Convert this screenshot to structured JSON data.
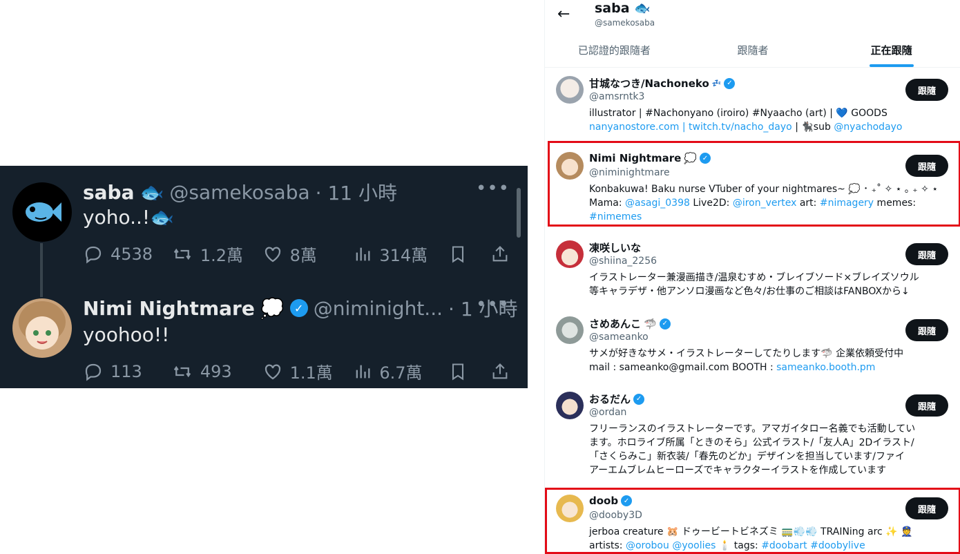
{
  "left_panel": {
    "tweets": [
      {
        "name": "saba",
        "name_emoji": "🐟",
        "handle": "@samekosaba",
        "time": "· 11 小時",
        "more": "•••",
        "text": "yoho..!",
        "text_emoji": "🐟",
        "replies": "4538",
        "retweets": "1.2萬",
        "likes": "8萬",
        "views": "314萬"
      },
      {
        "name": "Nimi Nightmare",
        "name_emoji": "💭",
        "handle": "@niminight...",
        "time": "· 1 小時",
        "more": "•••",
        "text": "yoohoo!!",
        "replies": "113",
        "retweets": "493",
        "likes": "1.1萬",
        "views": "6.7萬"
      }
    ]
  },
  "right_panel": {
    "back": "←",
    "title": "saba",
    "title_emoji": "🐟",
    "subtitle": "@samekosaba",
    "tabs": [
      "已認證的跟隨者",
      "跟隨者",
      "正在跟隨"
    ],
    "active_tab": 2,
    "follow_label": "跟隨",
    "users": [
      {
        "name": "甘城なつき/Nachoneko",
        "name_suffix": "💤",
        "handle": "@amsrntk3",
        "bio_line1": "illustrator | #Nachonyano (iroiro) #Nyaacho (art) | 💙 GOODS",
        "bio_line2_links": "nanyanostore.com | twitch.tv/nacho_dayo",
        "bio_line2_text": " | 🐈‍⬛sub ",
        "bio_line2_link2": "@nyachodayo"
      },
      {
        "name": "Nimi Nightmare",
        "name_suffix": "💭",
        "handle": "@niminightmare",
        "bio_line1": "Konbakuwa! Baku nurse VTuber of your nightmares~ 💭 ･ ₊˚ ✧ ⋆ ｡ ₊ ✧ ⋆",
        "bio_line2_a": "Mama: ",
        "bio_line2_b": "@asagi_0398",
        "bio_line2_c": " Live2D: ",
        "bio_line2_d": "@iron_vertex",
        "bio_line2_e": " art: ",
        "bio_line2_f": "#nimagery",
        "bio_line2_g": " memes:",
        "bio_line3": "#nimemes"
      },
      {
        "name": "凍咲しいな",
        "handle": "@shiina_2256",
        "bio_line1": "イラストレーター兼漫画描き/温泉むすめ・ブレイブソード×ブレイズソウル",
        "bio_line2": "等キャラデザ・他アンソロ漫画など色々/お仕事のご相談はFANBOXから↓"
      },
      {
        "name": "さめあんこ",
        "name_suffix": "🦈",
        "handle": "@sameanko",
        "bio_line1": "サメが好きなサメ・イラストレーターしてたりします🦈 企業依頼受付中",
        "bio_line2_text": "mail : sameanko@gmail.com BOOTH : ",
        "bio_line2_link": "sameanko.booth.pm"
      },
      {
        "name": "おるだん",
        "handle": "@ordan",
        "bio_line1": "フリーランスのイラストレーターです。アマガイタロー名義でも活動してい",
        "bio_line2": "ます。ホロライブ所属「ときのそら」公式イラスト/「友人A」2Dイラスト/",
        "bio_line3": "「さくらみこ」新衣装/「春先のどか」デザインを担当しています/ファイ",
        "bio_line4": "アーエムブレムヒーローズでキャラクターイラストを作成しています"
      },
      {
        "name": "doob",
        "handle": "@dooby3D",
        "bio_line1": "jerboa creature 🐹 ドゥービートビネズミ 🚃💨💨 TRAINing arc ✨ 👮",
        "bio_line2_a": "artists: ",
        "bio_line2_b": "@orobou @yoolies",
        "bio_line2_c": " 🕯️ tags: ",
        "bio_line2_d": "#doobart #doobylive"
      }
    ]
  },
  "colors": {
    "dark_bg": "#15202b",
    "accent": "#1d9bf0",
    "highlight": "#e30b17"
  }
}
